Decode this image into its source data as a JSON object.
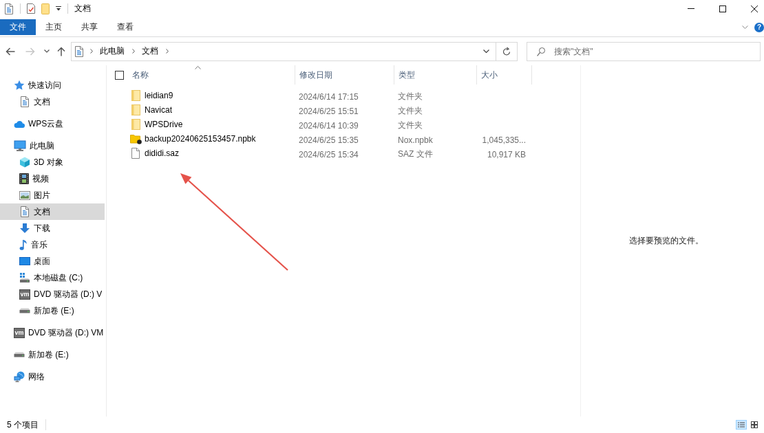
{
  "window": {
    "title": "文档"
  },
  "ribbon": {
    "tabs": [
      {
        "label": "文件",
        "selected": true
      },
      {
        "label": "主页",
        "selected": false
      },
      {
        "label": "共享",
        "selected": false
      },
      {
        "label": "查看",
        "selected": false
      }
    ],
    "help_label": "?"
  },
  "navigation": {
    "buttons": [
      {
        "kind": "back",
        "disabled": false
      },
      {
        "kind": "forward",
        "disabled": true
      },
      {
        "kind": "recent",
        "disabled": false
      },
      {
        "kind": "up",
        "disabled": false
      }
    ]
  },
  "address_bar": {
    "crumbs": [
      "此电脑",
      "文档"
    ]
  },
  "search": {
    "placeholder": "搜索\"文档\""
  },
  "sidebar": {
    "items": [
      {
        "label": "快速访问",
        "kind": "star",
        "selected": false,
        "children": [
          {
            "label": "文档",
            "kind": "document",
            "selected": false
          }
        ]
      },
      {
        "label": "WPS云盘",
        "kind": "cloud",
        "selected": false
      },
      {
        "label": "此电脑",
        "kind": "computer",
        "selected": false,
        "children": [
          {
            "label": "3D 对象",
            "kind": "cube",
            "selected": false
          },
          {
            "label": "视频",
            "kind": "video",
            "selected": false
          },
          {
            "label": "图片",
            "kind": "picture",
            "selected": false
          },
          {
            "label": "文档",
            "kind": "document",
            "selected": true
          },
          {
            "label": "下载",
            "kind": "download",
            "selected": false
          },
          {
            "label": "音乐",
            "kind": "music",
            "selected": false
          },
          {
            "label": "桌面",
            "kind": "desktop",
            "selected": false
          },
          {
            "label": "本地磁盘 (C:)",
            "kind": "system-drive",
            "selected": false
          },
          {
            "label": "DVD 驱动器 (D:) V",
            "kind": "dvd",
            "logo_text": "vm",
            "selected": false
          },
          {
            "label": "新加卷 (E:)",
            "kind": "drive",
            "selected": false
          }
        ]
      },
      {
        "label": "DVD 驱动器 (D:) VM",
        "kind": "dvd",
        "logo_text": "vm",
        "selected": false
      },
      {
        "label": "新加卷 (E:)",
        "kind": "drive",
        "selected": false
      },
      {
        "label": "网络",
        "kind": "network",
        "selected": false
      }
    ]
  },
  "file_list": {
    "select_all": {
      "checked": false
    },
    "columns": [
      {
        "label": "名称",
        "sorted": true
      },
      {
        "label": "修改日期",
        "sorted": false
      },
      {
        "label": "类型",
        "sorted": false
      },
      {
        "label": "大小",
        "sorted": false
      }
    ],
    "rows": [
      {
        "kind": "folder",
        "name": "leidian9",
        "modified": "2024/6/14 17:15",
        "type": "文件夹",
        "selected": false
      },
      {
        "kind": "folder",
        "name": "Navicat",
        "modified": "2024/6/25 15:51",
        "type": "文件夹",
        "selected": false
      },
      {
        "kind": "folder",
        "name": "WPSDrive",
        "modified": "2024/6/14 10:39",
        "type": "文件夹",
        "selected": false
      },
      {
        "kind": "backup",
        "name": "backup20240625153457.npbk",
        "modified": "2024/6/25 15:35",
        "type": "Nox.npbk",
        "size": "1,045,335...",
        "selected": false
      },
      {
        "kind": "file",
        "name": "dididi.saz",
        "modified": "2024/6/25 15:34",
        "type": "SAZ 文件",
        "size": "10,917 KB",
        "selected": false
      }
    ]
  },
  "preview": {
    "message": "选择要预览的文件。"
  },
  "status_bar": {
    "item_count": "5 个项目",
    "view_buttons": [
      {
        "kind": "details",
        "selected": true
      },
      {
        "kind": "large-icons",
        "selected": false
      }
    ]
  }
}
